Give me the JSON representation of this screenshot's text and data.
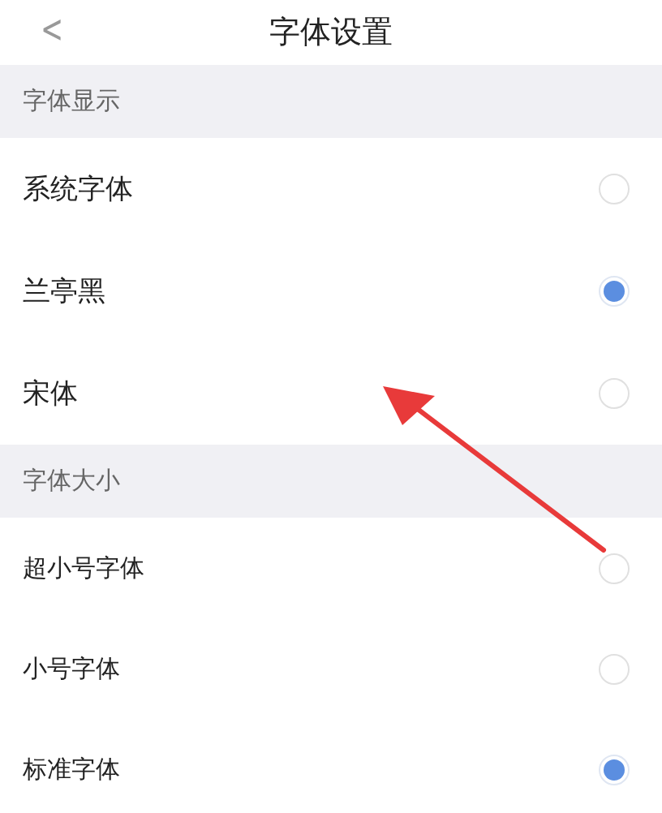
{
  "header": {
    "back": "<",
    "title": "字体设置"
  },
  "sections": [
    {
      "title": "字体显示",
      "kind": "display",
      "options": [
        {
          "label": "系统字体",
          "selected": false
        },
        {
          "label": "兰亭黑",
          "selected": true
        },
        {
          "label": "宋体",
          "selected": false
        }
      ]
    },
    {
      "title": "字体大小",
      "kind": "size",
      "options": [
        {
          "label": "超小号字体",
          "selected": false
        },
        {
          "label": "小号字体",
          "selected": false
        },
        {
          "label": "标准字体",
          "selected": true
        }
      ]
    }
  ],
  "annotations": [
    {
      "kind": "arrow"
    }
  ]
}
